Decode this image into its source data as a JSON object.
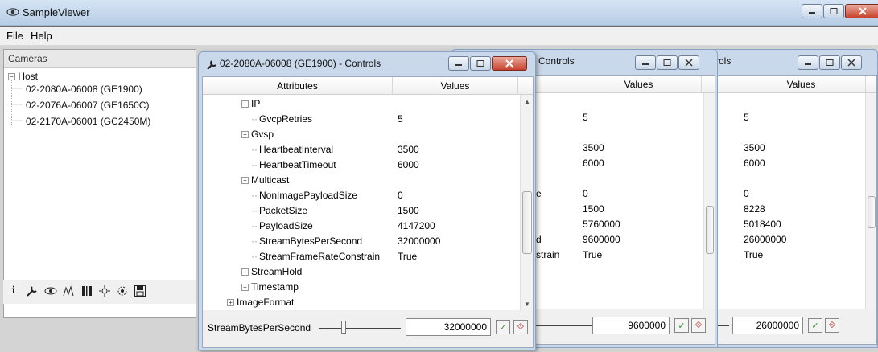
{
  "app": {
    "title": "SampleViewer"
  },
  "menu": [
    {
      "label": "File"
    },
    {
      "label": "Help"
    }
  ],
  "cameras": {
    "header": "Cameras",
    "root": "Host",
    "devices": [
      "02-2080A-06008 (GE1900)",
      "02-2076A-06007 (GE1650C)",
      "02-2170A-06001 (GC2450M)"
    ],
    "toolbar_icons": [
      "info-icon",
      "wrench-icon",
      "eye-icon",
      "histogram-icon",
      "barcode-icon",
      "gige-icon",
      "settings-icon",
      "save-icon"
    ]
  },
  "controls_main": {
    "title": "02-2080A-06008 (GE1900) - Controls",
    "col_attributes": "Attributes",
    "col_values": "Values",
    "rows": [
      {
        "name": "IP",
        "value": "",
        "expandable": true
      },
      {
        "name": "GvcpRetries",
        "value": "5",
        "expandable": false
      },
      {
        "name": "Gvsp",
        "value": "",
        "expandable": true
      },
      {
        "name": "HeartbeatInterval",
        "value": "3500",
        "expandable": false
      },
      {
        "name": "HeartbeatTimeout",
        "value": "6000",
        "expandable": false
      },
      {
        "name": "Multicast",
        "value": "",
        "expandable": true
      },
      {
        "name": "NonImagePayloadSize",
        "value": "0",
        "expandable": false
      },
      {
        "name": "PacketSize",
        "value": "1500",
        "expandable": false
      },
      {
        "name": "PayloadSize",
        "value": "4147200",
        "expandable": false
      },
      {
        "name": "StreamBytesPerSecond",
        "value": "32000000",
        "expandable": false
      },
      {
        "name": "StreamFrameRateConstrain",
        "value": "True",
        "expandable": false
      },
      {
        "name": "StreamHold",
        "value": "",
        "expandable": true
      },
      {
        "name": "Timestamp",
        "value": "",
        "expandable": true
      }
    ],
    "bottom_row": {
      "name": "ImageFormat",
      "expandable": true
    },
    "footer_label": "StreamBytesPerSecond",
    "footer_value": "32000000"
  },
  "controls_second": {
    "title": "Controls",
    "col_values": "Values",
    "name_fragments": [
      "",
      "",
      "",
      "",
      "",
      "",
      "e",
      "",
      "",
      "d",
      "strain",
      "",
      ""
    ],
    "values": [
      "",
      "5",
      "",
      "3500",
      "6000",
      "",
      "0",
      "1500",
      "5760000",
      "9600000",
      "True",
      "",
      ""
    ],
    "footer_value": "9600000"
  },
  "controls_third": {
    "title": "rols",
    "col_values": "Values",
    "values": [
      "",
      "5",
      "",
      "3500",
      "6000",
      "",
      "0",
      "8228",
      "5018400",
      "26000000",
      "True",
      "",
      ""
    ],
    "footer_value": "26000000"
  },
  "colors": {
    "titlebar": "#c6d8ee",
    "close": "#c7422c",
    "accent_ok": "#2a9a2a",
    "accent_reset": "#c02020"
  }
}
